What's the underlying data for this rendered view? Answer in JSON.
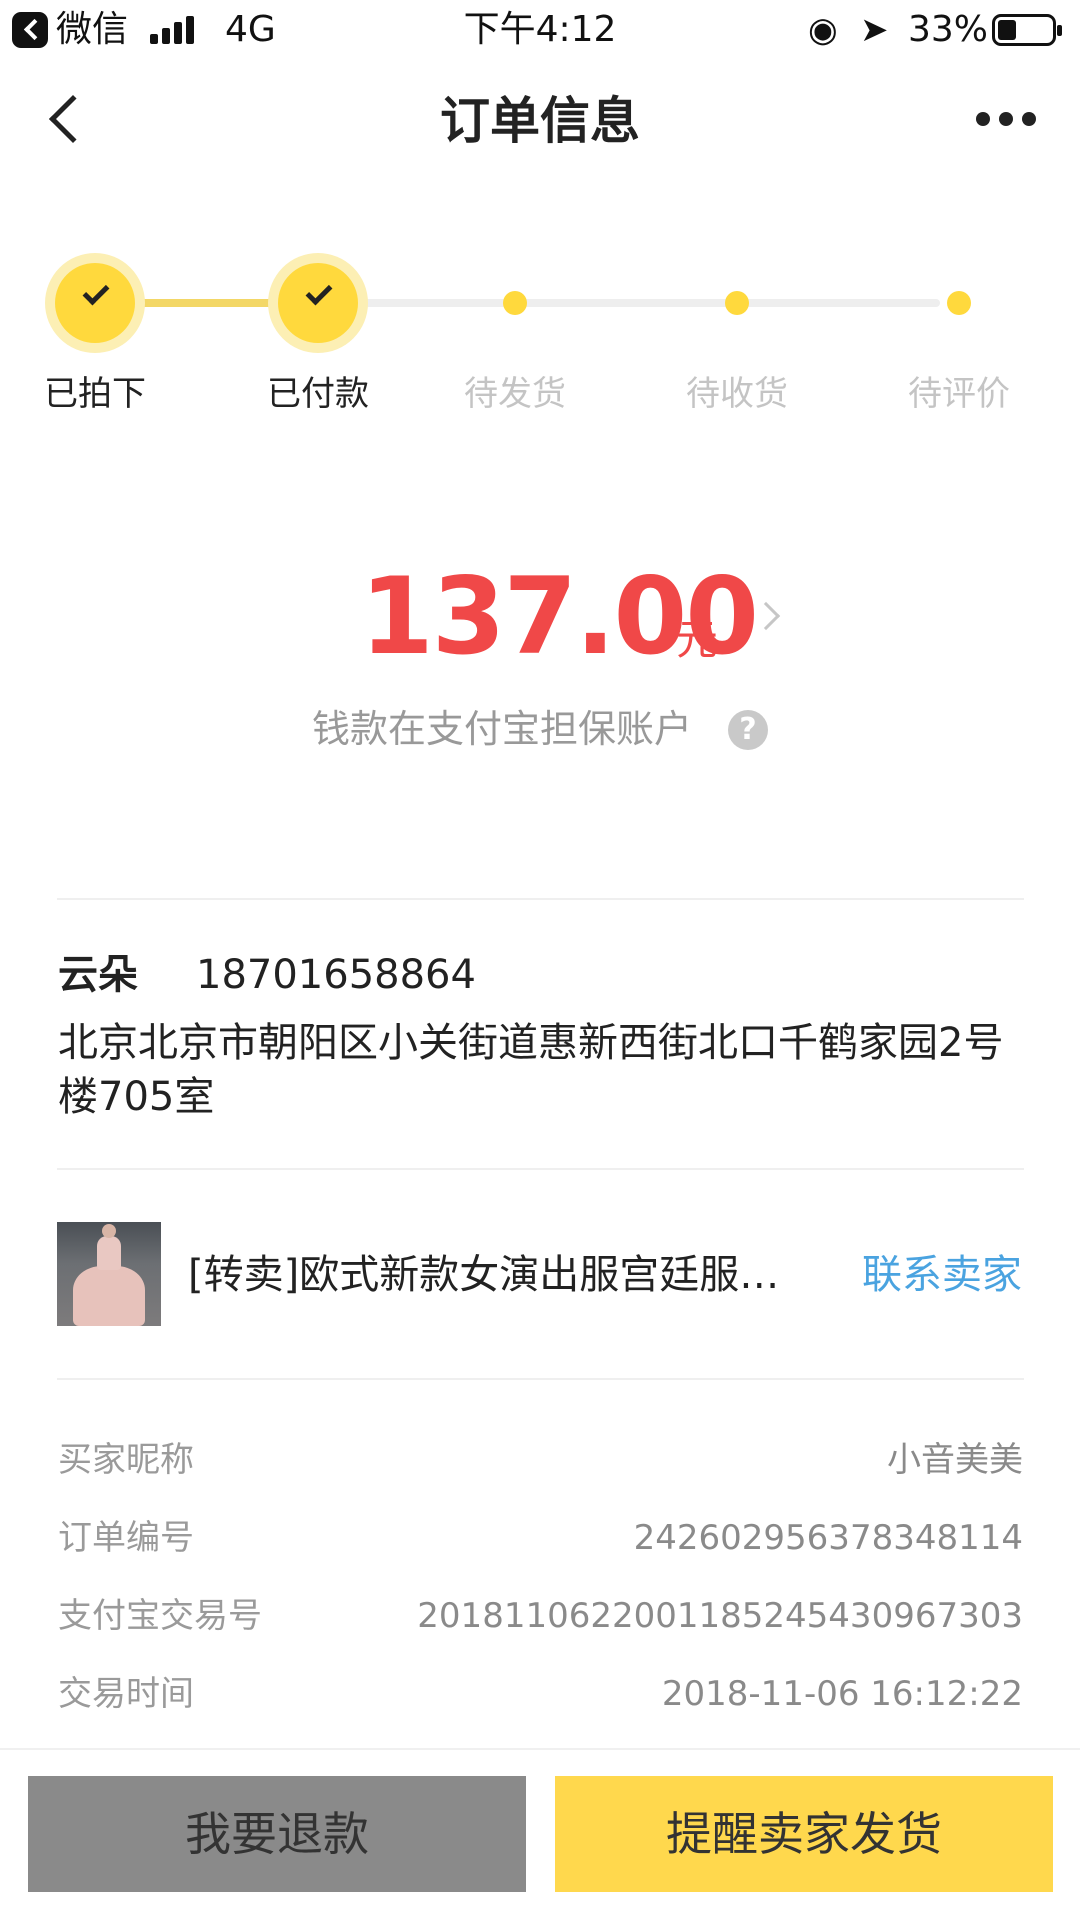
{
  "status_bar": {
    "back_app": "微信",
    "network": "4G",
    "time": "下午4:12",
    "battery": "33%",
    "battery_level": 0.33
  },
  "nav": {
    "title": "订单信息"
  },
  "steps": [
    {
      "label": "已拍下",
      "done": true
    },
    {
      "label": "已付款",
      "done": true
    },
    {
      "label": "待发货",
      "done": false
    },
    {
      "label": "待收货",
      "done": false
    },
    {
      "label": "待评价",
      "done": false
    }
  ],
  "amount": {
    "value": "137.00",
    "unit": "元",
    "escrow_note": "钱款在支付宝担保账户",
    "help_glyph": "?"
  },
  "address": {
    "name": "云朵",
    "phone": "18701658864",
    "line": "北京北京市朝阳区小关街道惠新西街北口千鹤家园2号楼705室"
  },
  "product": {
    "title": "[转卖]欧式新款女演出服宫廷服…",
    "contact_label": "联系卖家"
  },
  "info": [
    {
      "label": "买家昵称",
      "value": "小音美美"
    },
    {
      "label": "订单编号",
      "value": "2426029563783481​14"
    },
    {
      "label": "支付宝交易号",
      "value": "2018110622001185245430967303"
    },
    {
      "label": "交易时间",
      "value": "2018-11-06 16:12:22"
    }
  ],
  "buttons": {
    "refund": "我要退款",
    "remind": "提醒卖家发货"
  },
  "colors": {
    "accent_yellow": "#ffd93d",
    "price_red": "#f04848",
    "link_blue": "#4aa3e0",
    "refund_gray": "#8a8a8a"
  }
}
